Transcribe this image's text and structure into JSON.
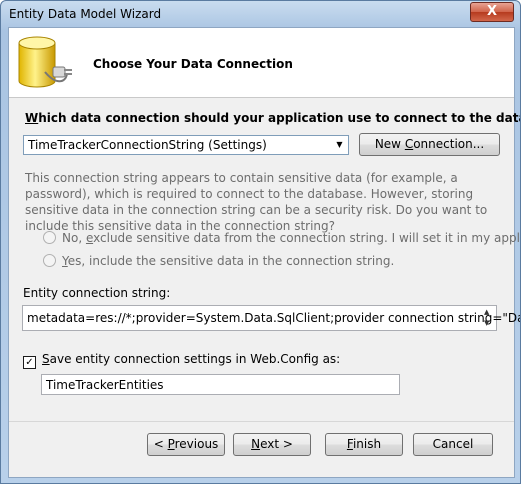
{
  "window": {
    "title": "Entity Data Model Wizard",
    "close_glyph": "X"
  },
  "header": {
    "title": "Choose Your Data Connection",
    "icon": "database-plug-icon"
  },
  "question": {
    "pre": "",
    "key": "W",
    "post": "hich data connection should your application use to connect to the database?"
  },
  "connection_select": {
    "value": "TimeTrackerConnectionString (Settings)",
    "arrow_glyph": "▼"
  },
  "new_connection_button": {
    "pre": "New ",
    "key": "C",
    "post": "onnection..."
  },
  "warning_text": "This connection string appears to contain sensitive data (for example, a password), which is required to connect to the database.  However, storing sensitive data in the connection string can be a security risk. Do you want to include this sensitive data in the connection string?",
  "radio_no": {
    "pre": "No, ",
    "key": "e",
    "post": "xclude sensitive data from the connection string. I will set it in my application code."
  },
  "radio_yes": {
    "pre": "",
    "key": "Y",
    "post": "es, include the sensitive data in the connection string."
  },
  "entity_connection": {
    "label": "Entity connection string:",
    "value": "metadata=res://*;provider=System.Data.SqlClient;provider connection string=\"Data",
    "spin_up": "▲",
    "spin_down": "▼"
  },
  "save_settings": {
    "checked": true,
    "check_glyph": "✓",
    "pre": "",
    "key": "S",
    "post": "ave entity connection settings in Web.Config as:",
    "value": "TimeTrackerEntities"
  },
  "buttons": {
    "previous": {
      "pre": "< ",
      "key": "P",
      "post": "revious"
    },
    "next": {
      "pre": "",
      "key": "N",
      "post": "ext >"
    },
    "finish": {
      "pre": "",
      "key": "F",
      "post": "inish"
    },
    "cancel": {
      "label": "Cancel"
    }
  },
  "colors": {
    "title_bar": "#b8d0ea",
    "close_button": "#c4462a",
    "disabled_text": "#6d6d6d"
  }
}
